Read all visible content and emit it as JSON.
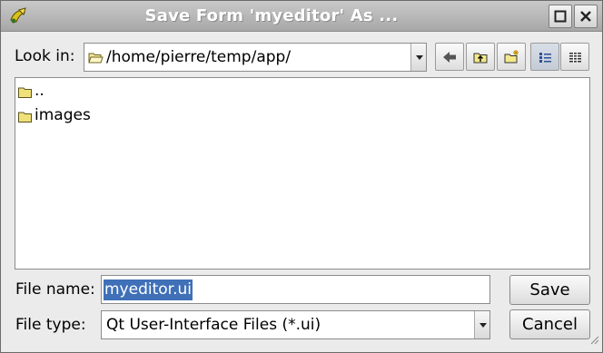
{
  "window": {
    "title": "Save Form 'myeditor' As ..."
  },
  "look_in": {
    "label": "Look in:",
    "path": "/home/pierre/temp/app/"
  },
  "toolbar": {
    "buttons": [
      "back-icon",
      "parent-folder-icon",
      "new-folder-icon",
      "list-view-icon",
      "detail-view-icon"
    ]
  },
  "file_list": {
    "items": [
      {
        "name": "..",
        "icon": "folder-icon"
      },
      {
        "name": "images",
        "icon": "folder-icon"
      }
    ]
  },
  "file_name": {
    "label": "File name:",
    "value": "myeditor.ui"
  },
  "file_type": {
    "label": "File type:",
    "value": "Qt User-Interface Files (*.ui)"
  },
  "buttons": {
    "save": "Save",
    "cancel": "Cancel"
  },
  "colors": {
    "title_bar": "#b5b5b5",
    "selection": "#3f70b8",
    "folder": "#e8d36a"
  }
}
